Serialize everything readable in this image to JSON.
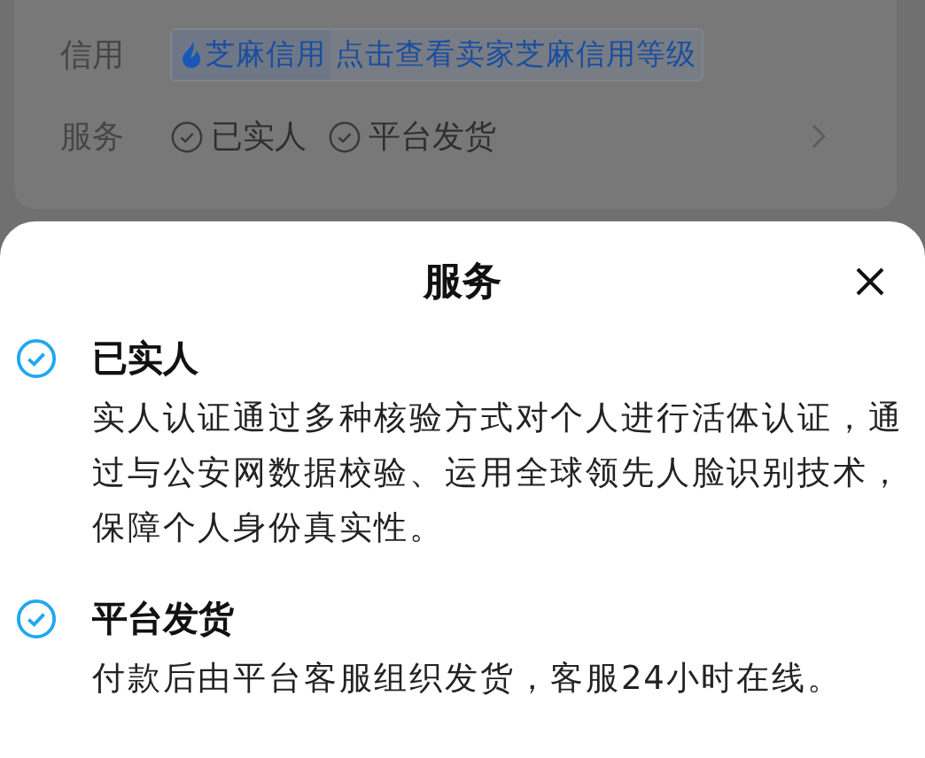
{
  "background": {
    "rows": [
      {
        "kind": "credit",
        "label": "信用",
        "badge": "芝麻信用",
        "link": "点击查看卖家芝麻信用等级"
      },
      {
        "kind": "services",
        "label": "服务",
        "tags": [
          "已实人",
          "平台发货"
        ]
      }
    ]
  },
  "sheet": {
    "title": "服务",
    "items": [
      {
        "title": "已实人",
        "description": "实人认证通过多种核验方式对个人进行活体认证，通过与公安网数据校验、运用全球领先人脸识别技术，保障个人身份真实性。"
      },
      {
        "title": "平台发货",
        "description": "付款后由平台客服组织发货，客服24小时在线。"
      }
    ]
  }
}
